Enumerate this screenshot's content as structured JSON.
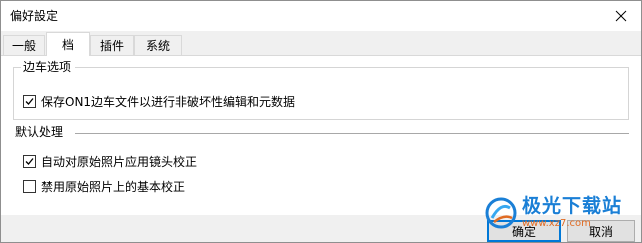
{
  "window": {
    "title": "偏好設定",
    "close_label": "✕"
  },
  "tabs": [
    {
      "label": "一般",
      "active": false
    },
    {
      "label": "档",
      "active": true
    },
    {
      "label": "插件",
      "active": false
    },
    {
      "label": "系统",
      "active": false
    }
  ],
  "sidecar": {
    "title": "边车选项",
    "items": [
      {
        "label": "保存ON1边车文件以进行非破坏性编辑和元数据",
        "checked": true
      }
    ]
  },
  "default_processing": {
    "title": "默认处理",
    "items": [
      {
        "label": "自动对原始照片应用镜头校正",
        "checked": true
      },
      {
        "label": "禁用原始照片上的基本校正",
        "checked": false
      }
    ]
  },
  "footer": {
    "ok_label": "确定",
    "cancel_label": "取消"
  },
  "watermark": {
    "main": "极光下载站",
    "sub": "www.xz7.com"
  }
}
